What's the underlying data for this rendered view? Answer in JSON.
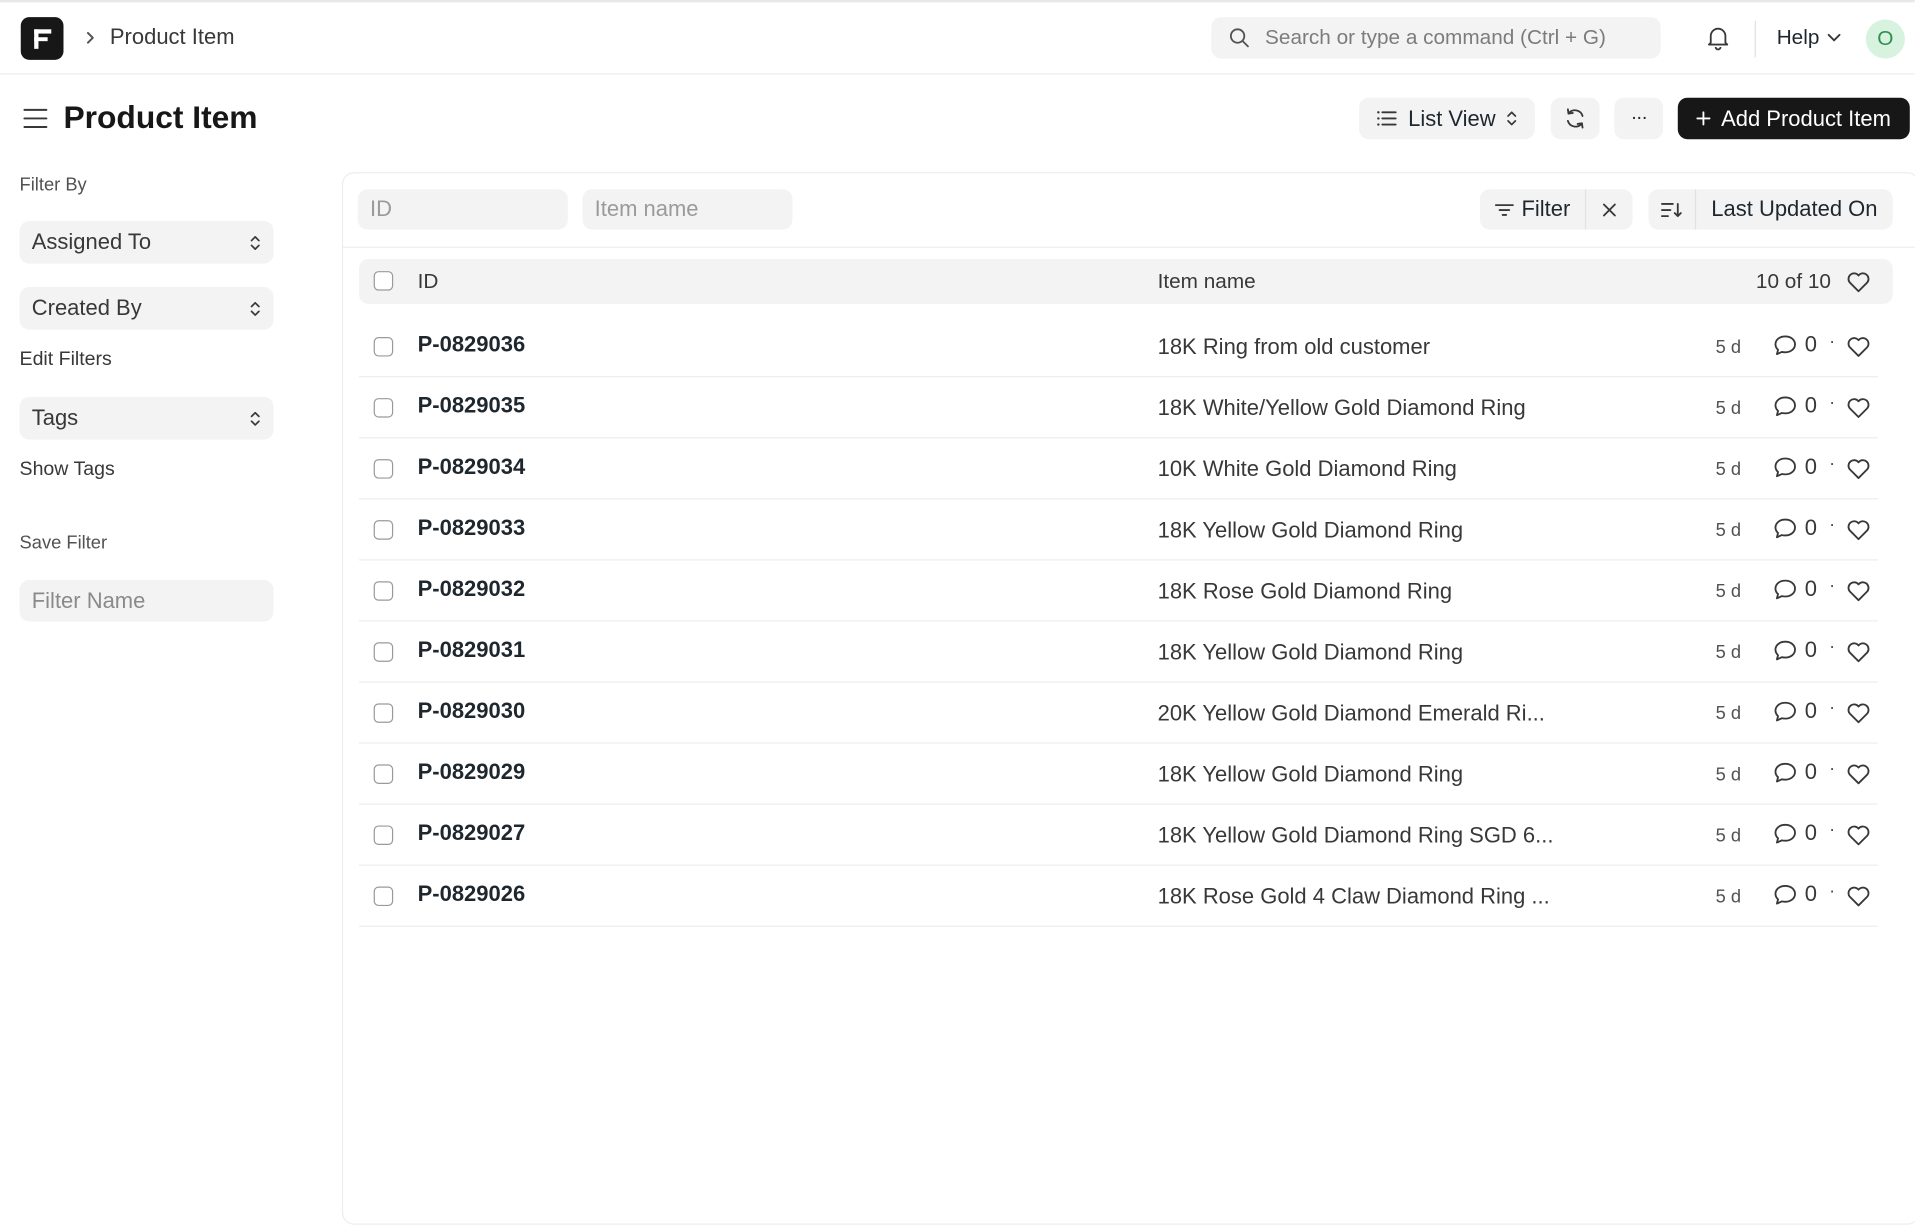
{
  "navbar": {
    "breadcrumb": "Product Item",
    "search_placeholder": "Search or type a command (Ctrl + G)",
    "help_label": "Help",
    "avatar_initial": "O",
    "logo_letter": "F"
  },
  "header": {
    "title": "Product Item",
    "list_view_label": "List View",
    "more_label": "···",
    "add_button_label": "Add Product Item"
  },
  "sidebar": {
    "filter_by_label": "Filter By",
    "assigned_to": "Assigned To",
    "created_by": "Created By",
    "edit_filters": "Edit Filters",
    "tags": "Tags",
    "show_tags": "Show Tags",
    "save_filter_label": "Save Filter",
    "filter_name_placeholder": "Filter Name"
  },
  "filters": {
    "id_placeholder": "ID",
    "item_name_placeholder": "Item name",
    "filter_label": "Filter",
    "sort_label": "Last Updated On"
  },
  "table": {
    "col_id": "ID",
    "col_item_name": "Item name",
    "count": "10 of 10",
    "rows": [
      {
        "id": "P-0829036",
        "name": "18K Ring from old customer",
        "time": "5 d",
        "comments": "0"
      },
      {
        "id": "P-0829035",
        "name": "18K White/Yellow Gold Diamond Ring",
        "time": "5 d",
        "comments": "0"
      },
      {
        "id": "P-0829034",
        "name": "10K White Gold Diamond Ring",
        "time": "5 d",
        "comments": "0"
      },
      {
        "id": "P-0829033",
        "name": "18K Yellow Gold Diamond Ring",
        "time": "5 d",
        "comments": "0"
      },
      {
        "id": "P-0829032",
        "name": "18K Rose Gold Diamond Ring",
        "time": "5 d",
        "comments": "0"
      },
      {
        "id": "P-0829031",
        "name": "18K Yellow Gold Diamond Ring",
        "time": "5 d",
        "comments": "0"
      },
      {
        "id": "P-0829030",
        "name": "20K Yellow Gold Diamond Emerald Ri...",
        "time": "5 d",
        "comments": "0"
      },
      {
        "id": "P-0829029",
        "name": "18K Yellow Gold Diamond Ring",
        "time": "5 d",
        "comments": "0"
      },
      {
        "id": "P-0829027",
        "name": "18K Yellow Gold Diamond Ring SGD 6...",
        "time": "5 d",
        "comments": "0"
      },
      {
        "id": "P-0829026",
        "name": "18K Rose Gold 4 Claw Diamond Ring ...",
        "time": "5 d",
        "comments": "0"
      }
    ]
  },
  "colors": {
    "accent_dark": "#171717",
    "surface_gray": "#f3f3f3",
    "avatar_bg": "#d8f2e0",
    "avatar_text": "#2f8f4f"
  }
}
